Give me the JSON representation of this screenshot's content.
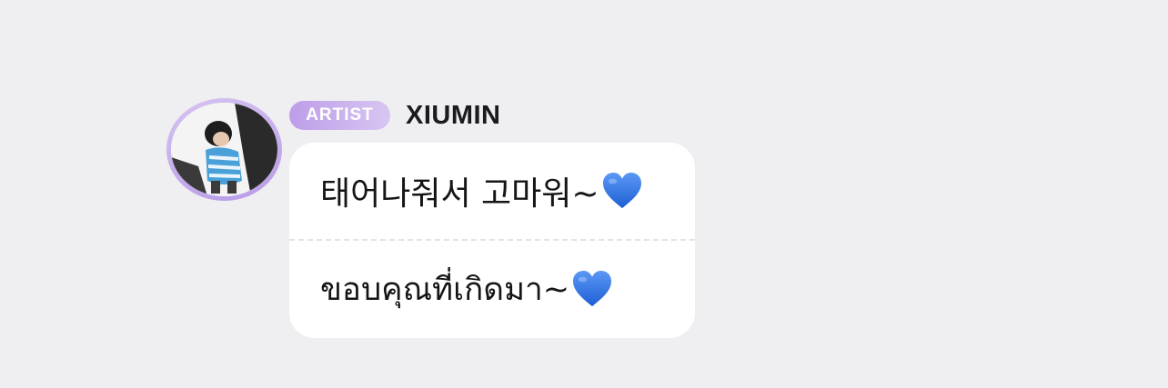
{
  "post": {
    "badge": "ARTIST",
    "author": "XIUMIN",
    "avatar_icon": "profile-photo",
    "messages": [
      {
        "text": "태어나줘서 고마워~",
        "emoji": "blue-heart"
      },
      {
        "text": "ขอบคุณที่เกิดมา~",
        "emoji": "blue-heart"
      }
    ]
  },
  "colors": {
    "background": "#efeff1",
    "bubble": "#ffffff",
    "badge_gradient_start": "#bd9de8",
    "badge_gradient_end": "#d7c6f1",
    "avatar_ring": "#c5acec",
    "heart": "#2f6fe0"
  }
}
